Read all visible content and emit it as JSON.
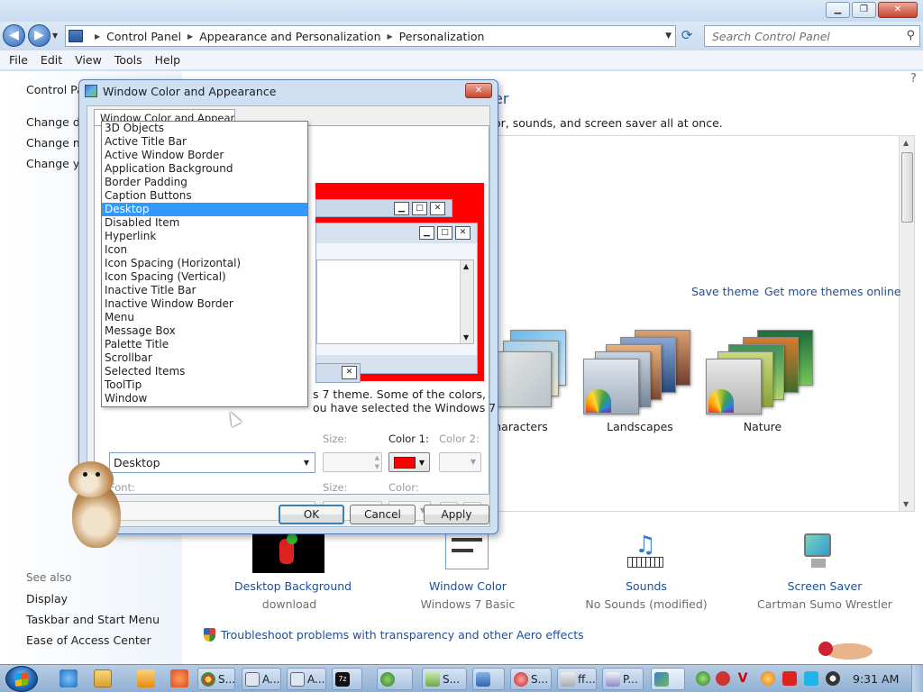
{
  "window": {
    "minimize_glyph": "▁",
    "maximize_glyph": "❐",
    "close_glyph": "✕"
  },
  "address": {
    "crumbs": [
      "Control Panel",
      "Appearance and Personalization",
      "Personalization"
    ],
    "back_glyph": "◀",
    "forward_glyph": "▶",
    "refresh_glyph": "⟳",
    "search_placeholder": "Search Control Panel",
    "search_icon_glyph": "⚲"
  },
  "menubar": [
    "File",
    "Edit",
    "View",
    "Tools",
    "Help"
  ],
  "leftpane": {
    "home": "Control Panel",
    "tasks": [
      "Change de",
      "Change mo",
      "Change yo"
    ],
    "see_also": "See also",
    "links": [
      "Display",
      "Taskbar and Start Menu",
      "Ease of Access Center"
    ]
  },
  "main": {
    "heading_fragment": "er",
    "description_fragment": "or, sounds, and screen saver all at once.",
    "save_theme": "Save theme",
    "get_more_themes": "Get more themes online",
    "themes": [
      {
        "label": "haracters"
      },
      {
        "label": "Landscapes"
      },
      {
        "label": "Nature"
      }
    ],
    "bottom_items": [
      {
        "title": "Desktop Background",
        "subtitle": "download"
      },
      {
        "title": "Window Color",
        "subtitle": "Windows 7 Basic"
      },
      {
        "title": "Sounds",
        "subtitle": "No Sounds (modified)"
      },
      {
        "title": "Screen Saver",
        "subtitle": "Cartman Sumo Wrestler"
      }
    ],
    "troubleshoot": "Troubleshoot problems with transparency and other Aero effects"
  },
  "dialog": {
    "title": "Window Color and Appearance",
    "close_glyph": "✕",
    "tab": "Window Color and Appearance",
    "info_line1": "s 7 theme.  Some of the colors,",
    "info_line2": "ou have selected the Windows 7",
    "labels": {
      "size": "Size:",
      "color1": "Color 1:",
      "color2": "Color 2:",
      "font": "Font:",
      "font_size": "Size:",
      "font_color": "Color:"
    },
    "item_selected": "Desktop",
    "item_options": [
      "3D Objects",
      "Active Title Bar",
      "Active Window Border",
      "Application Background",
      "Border Padding",
      "Caption Buttons",
      "Desktop",
      "Disabled Item",
      "Hyperlink",
      "Icon",
      "Icon Spacing (Horizontal)",
      "Icon Spacing (Vertical)",
      "Inactive Title Bar",
      "Inactive Window Border",
      "Menu",
      "Message Box",
      "Palette Title",
      "Scrollbar",
      "Selected Items",
      "ToolTip",
      "Window"
    ],
    "selected_index": 6,
    "bold_glyph": "B",
    "italic_glyph": "I",
    "buttons": {
      "ok": "OK",
      "cancel": "Cancel",
      "apply": "Apply"
    },
    "preview_glyphs": {
      "min": "▁",
      "max": "□",
      "close": "✕"
    },
    "color1_value": "#ff0000"
  },
  "taskbar": {
    "items": [
      "S...",
      "A...",
      "A...",
      "S...",
      "S...",
      "ff...",
      "P..."
    ],
    "clock": "9:31 AM"
  }
}
